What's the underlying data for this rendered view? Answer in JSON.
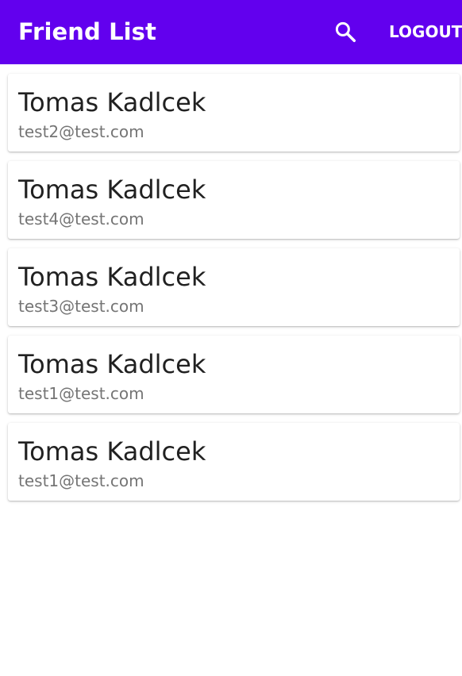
{
  "app_bar": {
    "title": "Friend List",
    "search_icon": "search-icon",
    "logout_label": "LOGOUT",
    "background": "#6200ee"
  },
  "friends": [
    {
      "name": "Tomas Kadlcek",
      "email": "test2@test.com"
    },
    {
      "name": "Tomas Kadlcek",
      "email": "test4@test.com"
    },
    {
      "name": "Tomas Kadlcek",
      "email": "test3@test.com"
    },
    {
      "name": "Tomas Kadlcek",
      "email": "test1@test.com"
    },
    {
      "name": "Tomas Kadlcek",
      "email": "test1@test.com"
    }
  ]
}
